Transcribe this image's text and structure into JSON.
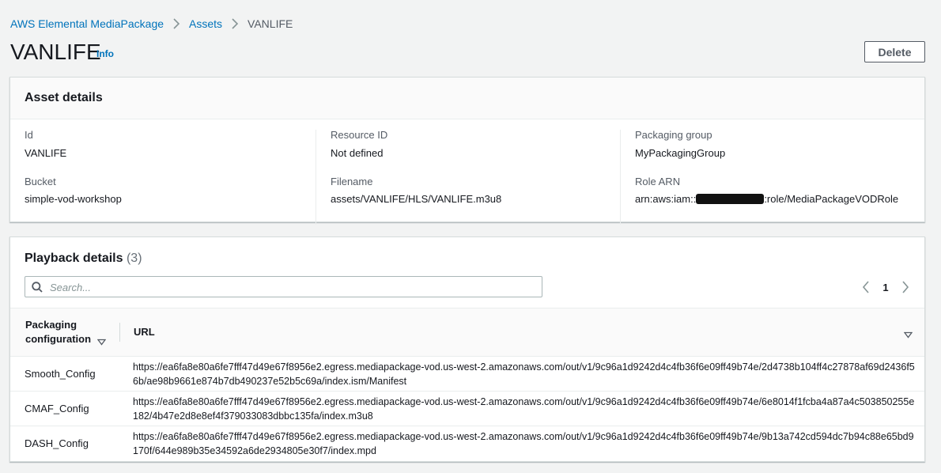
{
  "breadcrumb": {
    "items": [
      "AWS Elemental MediaPackage",
      "Assets"
    ],
    "current": "VANLIFE"
  },
  "header": {
    "title": "VANLIFE",
    "info_label": "Info",
    "delete_label": "Delete"
  },
  "asset_details": {
    "title": "Asset details",
    "fields": {
      "id": {
        "label": "Id",
        "value": "VANLIFE"
      },
      "resource_id": {
        "label": "Resource ID",
        "value": "Not defined"
      },
      "packaging_group": {
        "label": "Packaging group",
        "value": "MyPackagingGroup"
      },
      "bucket": {
        "label": "Bucket",
        "value": "simple-vod-workshop"
      },
      "filename": {
        "label": "Filename",
        "value": "assets/VANLIFE/HLS/VANLIFE.m3u8"
      },
      "role_arn": {
        "label": "Role ARN",
        "value_prefix": "arn:aws:iam::",
        "value_suffix": ":role/MediaPackageVODRole"
      }
    }
  },
  "playback": {
    "title": "Playback details",
    "count": "(3)",
    "search_placeholder": "Search...",
    "page": "1",
    "columns": {
      "config": "Packaging configuration",
      "url": "URL"
    },
    "rows": [
      {
        "config": "Smooth_Config",
        "url": "https://ea6fa8e80a6fe7fff47d49e67f8956e2.egress.mediapackage-vod.us-west-2.amazonaws.com/out/v1/9c96a1d9242d4c4fb36f6e09ff49b74e/2d4738b104ff4c27878af69d2436f56b/ae98b9661e874b7db490237e52b5c69a/index.ism/Manifest"
      },
      {
        "config": "CMAF_Config",
        "url": "https://ea6fa8e80a6fe7fff47d49e67f8956e2.egress.mediapackage-vod.us-west-2.amazonaws.com/out/v1/9c96a1d9242d4c4fb36f6e09ff49b74e/6e8014f1fcba4a87a4c503850255e182/4b47e2d8e8ef4f379033083dbbc135fa/index.m3u8"
      },
      {
        "config": "DASH_Config",
        "url": "https://ea6fa8e80a6fe7fff47d49e67f8956e2.egress.mediapackage-vod.us-west-2.amazonaws.com/out/v1/9c96a1d9242d4c4fb36f6e09ff49b74e/9b13a742cd594dc7b94c88e65bd9170f/644e989b35e34592a6de2934805e30f7/index.mpd"
      }
    ]
  },
  "colors": {
    "link": "#0073bb",
    "text": "#16191f",
    "secondary_text": "#545b64",
    "background": "#f2f3f3",
    "border": "#d5dbdb"
  },
  "icons": [
    "chevron-right-icon",
    "search-icon",
    "caret-down-icon",
    "chevron-left-icon"
  ]
}
